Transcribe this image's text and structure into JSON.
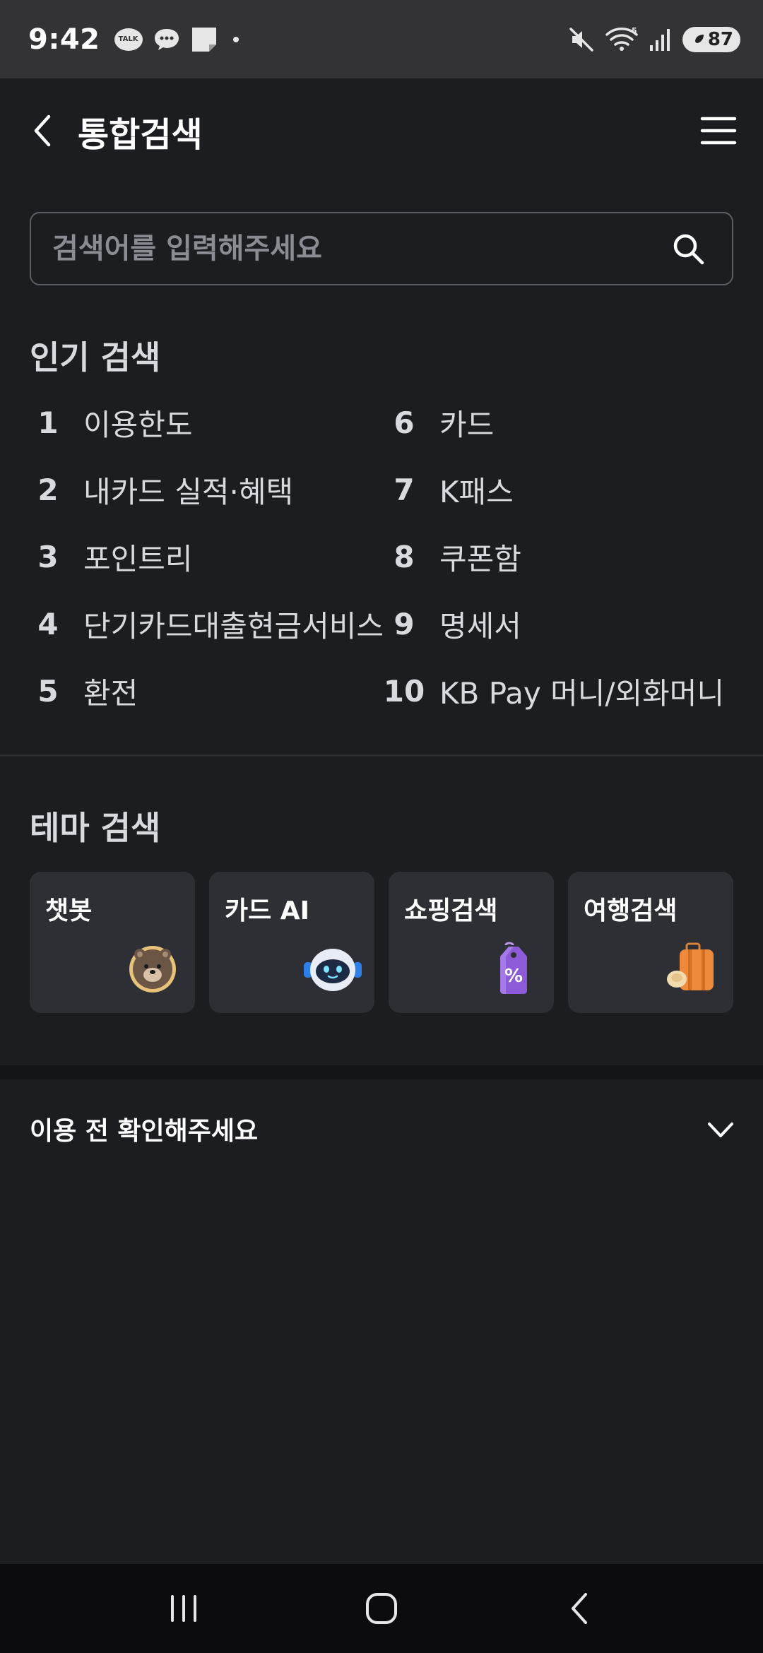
{
  "status_bar": {
    "time": "9:42",
    "talk_icon_text": "TALK",
    "network": "5",
    "battery": "87"
  },
  "header": {
    "title": "통합검색"
  },
  "search": {
    "placeholder": "검색어를 입력해주세요",
    "value": ""
  },
  "popular": {
    "title": "인기 검색",
    "items": [
      {
        "rank": "1",
        "term": "이용한도"
      },
      {
        "rank": "2",
        "term": "내카드 실적·혜택"
      },
      {
        "rank": "3",
        "term": "포인트리"
      },
      {
        "rank": "4",
        "term": "단기카드대출현금서비스"
      },
      {
        "rank": "5",
        "term": "환전"
      },
      {
        "rank": "6",
        "term": "카드"
      },
      {
        "rank": "7",
        "term": "K패스"
      },
      {
        "rank": "8",
        "term": "쿠폰함"
      },
      {
        "rank": "9",
        "term": "명세서"
      },
      {
        "rank": "10",
        "term": "KB Pay 머니/외화머니"
      }
    ]
  },
  "theme": {
    "title": "테마 검색",
    "cards": [
      {
        "label": "챗봇",
        "icon": "bear-icon"
      },
      {
        "label": "카드 AI",
        "icon": "robot-icon"
      },
      {
        "label": "쇼핑검색",
        "icon": "shopping-tag-icon"
      },
      {
        "label": "여행검색",
        "icon": "suitcase-icon"
      }
    ]
  },
  "notice": {
    "label": "이용 전 확인해주세요"
  },
  "colors": {
    "background": "#1c1d21",
    "status_bar": "#333335",
    "card": "#2e2f35",
    "nav_bar": "#0c0c0e"
  }
}
